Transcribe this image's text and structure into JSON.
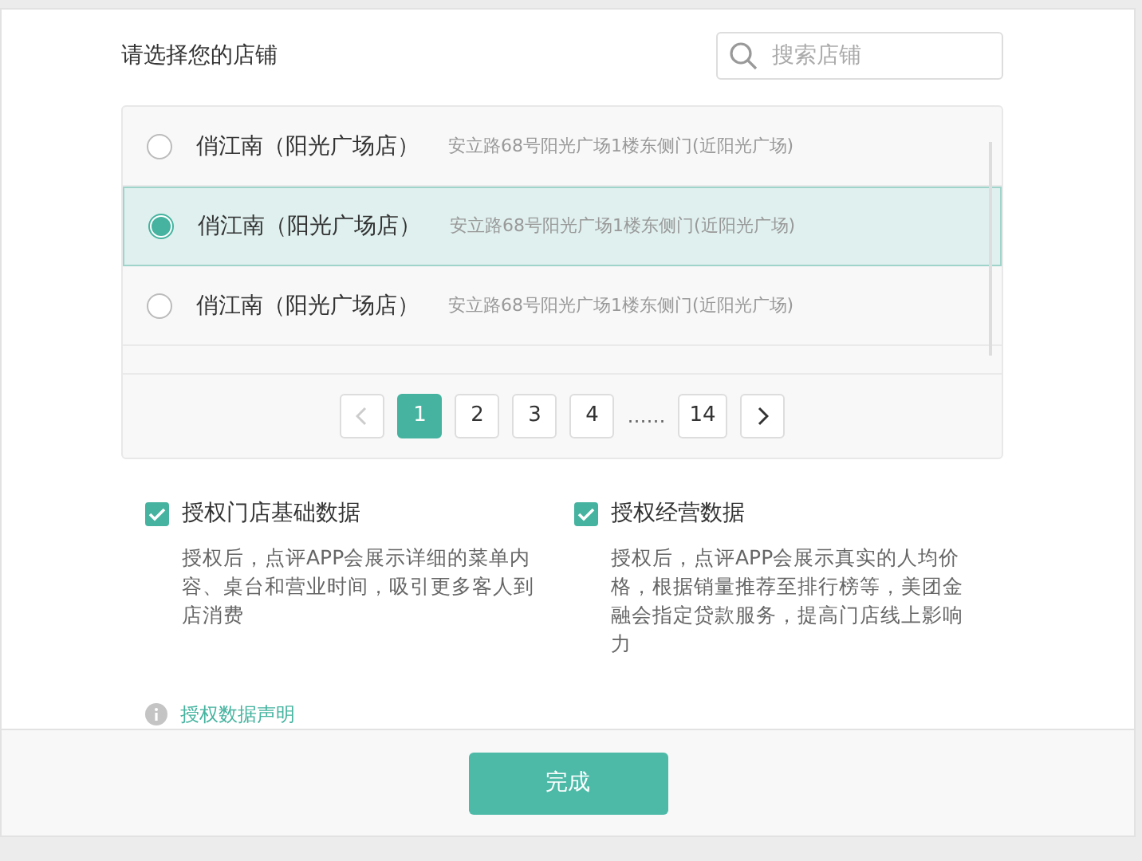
{
  "header": {
    "title": "请选择您的店铺",
    "search": {
      "placeholder": "搜索店铺"
    }
  },
  "stores": [
    {
      "name": "俏江南（阳光广场店）",
      "address": "安立路68号阳光广场1楼东侧门(近阳光广场)",
      "selected": false
    },
    {
      "name": "俏江南（阳光广场店）",
      "address": "安立路68号阳光广场1楼东侧门(近阳光广场)",
      "selected": true
    },
    {
      "name": "俏江南（阳光广场店）",
      "address": "安立路68号阳光广场1楼东侧门(近阳光广场)",
      "selected": false
    }
  ],
  "pagination": {
    "prev_disabled": true,
    "items": [
      {
        "kind": "page",
        "label": "1",
        "selected": true
      },
      {
        "kind": "page",
        "label": "2",
        "selected": false
      },
      {
        "kind": "page",
        "label": "3",
        "selected": false
      },
      {
        "kind": "page",
        "label": "4",
        "selected": false
      },
      {
        "kind": "ellipsis",
        "label": "……"
      },
      {
        "kind": "page",
        "label": "14",
        "selected": false
      }
    ]
  },
  "permissions": [
    {
      "label": "授权门店基础数据",
      "checked": true,
      "description": "授权后，点评APP会展示详细的菜单内容、桌台和营业时间，吸引更多客人到店消费"
    },
    {
      "label": "授权经营数据",
      "checked": true,
      "description": "授权后，点评APP会展示真实的人均价格，根据销量推荐至排行榜等，美团金融会指定贷款服务，提高门店线上影响力"
    }
  ],
  "statement_link": "授权数据声明",
  "footer": {
    "button": "完成"
  }
}
